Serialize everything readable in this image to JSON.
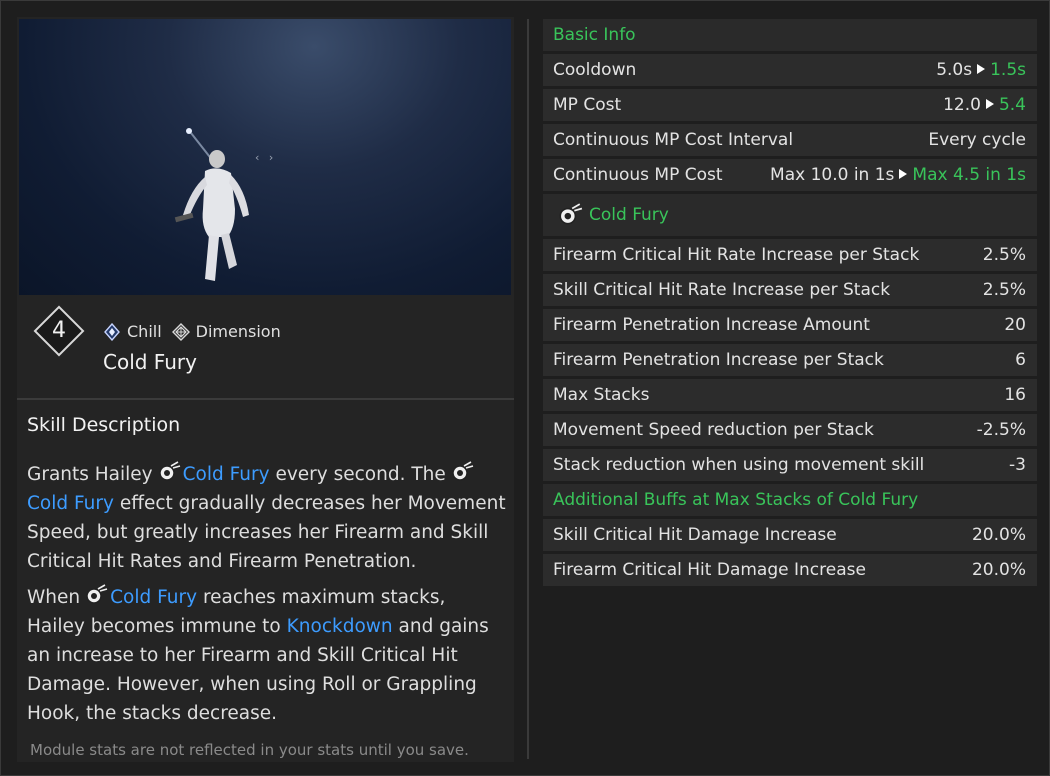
{
  "preview": {
    "move_hint": "‹ ›"
  },
  "skill": {
    "level": "4",
    "tags": [
      {
        "label": "Chill",
        "icon": "chill-element-icon"
      },
      {
        "label": "Dimension",
        "icon": "dimension-arche-icon"
      }
    ],
    "name": "Cold Fury"
  },
  "description": {
    "title": "Skill Description",
    "p1": {
      "a": "Grants Hailey",
      "kw1": "Cold Fury",
      "b": "every second. The",
      "kw2": "Cold Fury",
      "c": "effect gradually decreases her Movement Speed, but greatly increases her Firearm and Skill Critical Hit Rates and Firearm Penetration."
    },
    "p2": {
      "a": "When",
      "kw1": "Cold Fury",
      "b": "reaches maximum stacks, Hailey becomes immune to",
      "kw2": "Knockdown",
      "c": "and gains an increase to her Firearm and Skill Critical Hit Damage. However, when using Roll or Grappling Hook, the stacks decrease."
    },
    "footnote": "Module stats are not reflected in your stats until you save."
  },
  "stats": {
    "basic_header": "Basic Info",
    "cooldown": {
      "label": "Cooldown",
      "from": "5.0s",
      "to": "1.5s"
    },
    "mp_cost": {
      "label": "MP Cost",
      "from": "12.0",
      "to": "5.4"
    },
    "cont_interval": {
      "label": "Continuous MP Cost Interval",
      "value": "Every cycle"
    },
    "cont_cost": {
      "label": "Continuous MP Cost",
      "from": "Max 10.0 in 1s",
      "to": "Max 4.5 in 1s"
    },
    "effect_header": "Cold Fury",
    "effect_rows": [
      {
        "label": "Firearm Critical Hit Rate Increase per Stack",
        "value": "2.5%"
      },
      {
        "label": "Skill Critical Hit Rate Increase per Stack",
        "value": "2.5%"
      },
      {
        "label": "Firearm Penetration Increase Amount",
        "value": "20"
      },
      {
        "label": "Firearm Penetration Increase per Stack",
        "value": "6"
      },
      {
        "label": "Max Stacks",
        "value": "16"
      },
      {
        "label": "Movement Speed reduction per Stack",
        "value": "-2.5%"
      },
      {
        "label": "Stack reduction when using movement skill",
        "value": "-3"
      }
    ],
    "buff_header": "Additional Buffs at Max Stacks of Cold Fury",
    "buff_rows": [
      {
        "label": "Skill Critical Hit Damage Increase",
        "value": "20.0%"
      },
      {
        "label": "Firearm Critical Hit Damage Increase",
        "value": "20.0%"
      }
    ]
  },
  "colors": {
    "accent_green": "#39c45a",
    "keyword_blue": "#3d9cff",
    "panel": "#2c2c2c"
  }
}
